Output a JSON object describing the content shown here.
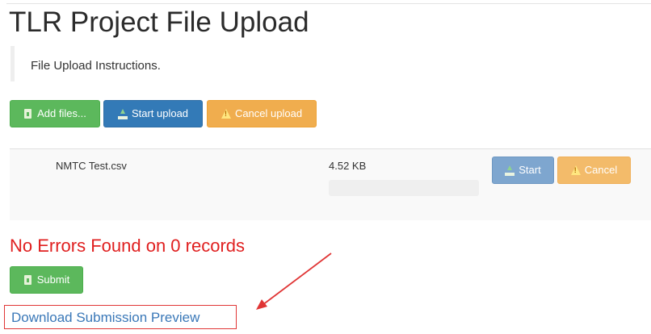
{
  "page": {
    "title": "TLR Project File Upload",
    "instructions": "File Upload Instructions."
  },
  "toolbar": {
    "add_files_label": "Add files...",
    "start_upload_label": "Start upload",
    "cancel_upload_label": "Cancel upload"
  },
  "files": [
    {
      "name": "NMTC Test.csv",
      "size": "4.52 KB",
      "progress": 0,
      "start_label": "Start",
      "cancel_label": "Cancel"
    }
  ],
  "status": {
    "message": "No Errors Found on 0 records"
  },
  "submit": {
    "label": "Submit"
  },
  "download": {
    "label": "Download Submission Preview"
  },
  "colors": {
    "success": "#5cb85c",
    "primary": "#337ab7",
    "warning": "#f0ad4e",
    "error_text": "#e02020",
    "link": "#3a78b8",
    "annotation": "#e03535"
  },
  "icons": {
    "add_files": "document-plus-icon",
    "start_upload": "upload-icon",
    "cancel_upload": "warning-icon",
    "submit": "document-icon"
  }
}
